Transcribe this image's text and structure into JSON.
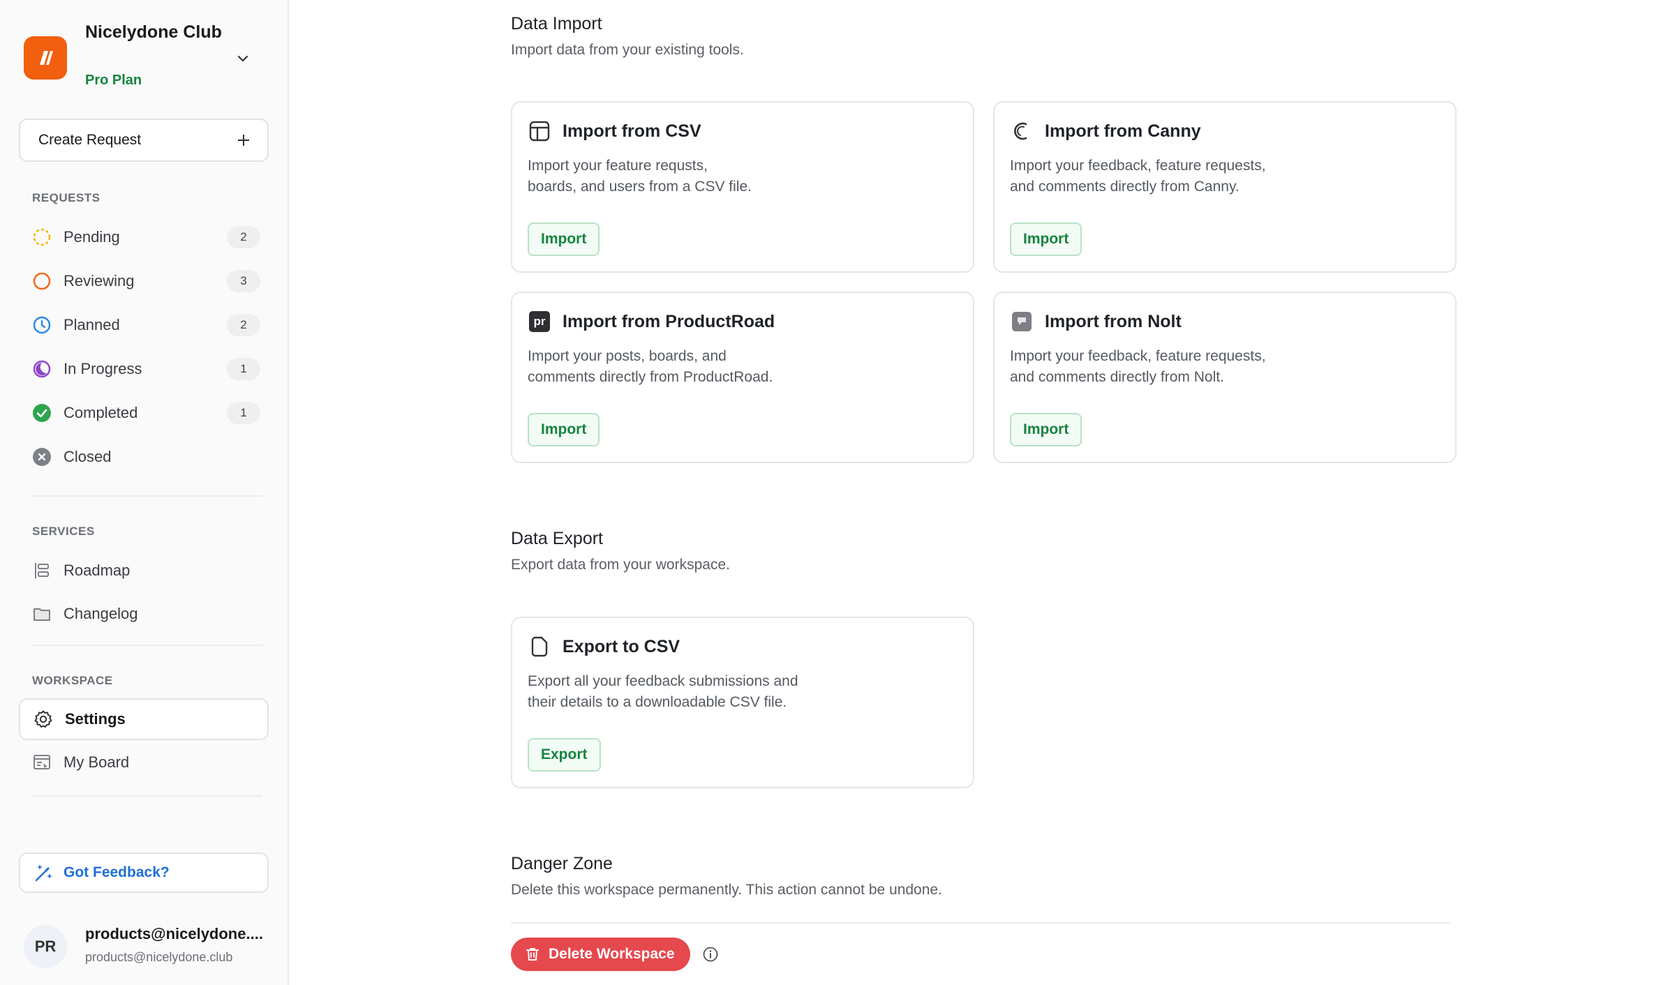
{
  "workspace": {
    "name": "Nicelydone Club",
    "plan": "Pro Plan"
  },
  "sidebar": {
    "create_label": "Create Request",
    "sections": {
      "requests": "REQUESTS",
      "services": "SERVICES",
      "workspace": "WORKSPACE"
    },
    "requests": [
      {
        "label": "Pending",
        "count": "2",
        "icon": "pending-dashed-circle-icon",
        "color": "#f5b400"
      },
      {
        "label": "Reviewing",
        "count": "3",
        "icon": "reviewing-circle-icon",
        "color": "#f26b1d"
      },
      {
        "label": "Planned",
        "count": "2",
        "icon": "planned-clock-icon",
        "color": "#2b87e3"
      },
      {
        "label": "In Progress",
        "count": "1",
        "icon": "in-progress-icon",
        "color": "#8e44c9"
      },
      {
        "label": "Completed",
        "count": "1",
        "icon": "completed-check-icon",
        "color": "#2ea44f"
      },
      {
        "label": "Closed",
        "icon": "closed-x-icon",
        "color": "#7d8087"
      }
    ],
    "services": [
      {
        "label": "Roadmap",
        "icon": "roadmap-icon"
      },
      {
        "label": "Changelog",
        "icon": "changelog-icon"
      }
    ],
    "workspace_items": [
      {
        "label": "Settings",
        "icon": "gear-icon",
        "active": true
      },
      {
        "label": "My Board",
        "icon": "board-icon"
      }
    ],
    "feedback_label": "Got Feedback?",
    "user": {
      "initials": "PR",
      "name": "products@nicelydone....",
      "email": "products@nicelydone.club"
    }
  },
  "main": {
    "data_import": {
      "title": "Data Import",
      "subtitle": "Import data from your existing tools.",
      "cards": [
        {
          "title": "Import from CSV",
          "desc1": "Import your feature requsts,",
          "desc2": "boards, and users from a CSV file.",
          "button": "Import",
          "icon": "csv-table-icon"
        },
        {
          "title": "Import from Canny",
          "desc1": "Import your feedback, feature requests,",
          "desc2": "and comments directly from Canny.",
          "button": "Import",
          "icon": "canny-logo-icon"
        },
        {
          "title": "Import from ProductRoad",
          "desc1": "Import your posts, boards, and",
          "desc2": "comments directly from ProductRoad.",
          "button": "Import",
          "icon": "productroad-logo-icon",
          "icon_text": "pr"
        },
        {
          "title": "Import from Nolt",
          "desc1": "Import your feedback, feature requests,",
          "desc2": "and comments directly from Nolt.",
          "button": "Import",
          "icon": "nolt-logo-icon"
        }
      ]
    },
    "data_export": {
      "title": "Data Export",
      "subtitle": "Export data from your workspace.",
      "card": {
        "title": "Export to CSV",
        "desc1": "Export all your feedback submissions and",
        "desc2": "their details to a downloadable CSV file.",
        "button": "Export",
        "icon": "file-icon"
      }
    },
    "danger_zone": {
      "title": "Danger Zone",
      "subtitle": "Delete this workspace permanently. This action cannot be undone.",
      "delete_label": "Delete Workspace"
    }
  },
  "colors": {
    "brand": "#f15f0f",
    "plan_green": "#16843f",
    "danger": "#e5484d",
    "link_blue": "#1f6fd6"
  }
}
